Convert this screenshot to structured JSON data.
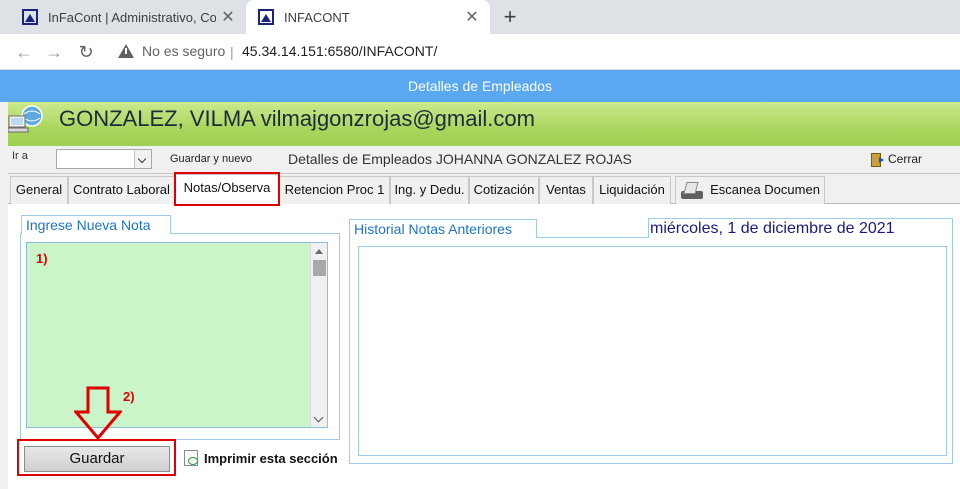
{
  "browser": {
    "tabs": [
      {
        "title": "InFaCont | Administrativo, Contab",
        "active": false
      },
      {
        "title": "INFACONT",
        "active": true
      }
    ],
    "close_glyph": "✕",
    "new_tab_glyph": "+",
    "security_label": "No es seguro",
    "url": "45.34.14.151:6580/INFACONT/"
  },
  "app": {
    "window_title": "Detalles de Empleados",
    "employee_banner": "GONZALEZ, VILMA vilmajgonzrojas@gmail.com",
    "toolbar": {
      "ir_a_label": "Ir a",
      "guardar_nuevo": "Guardar y nuevo",
      "detail_title": "Detalles de Empleados JOHANNA GONZALEZ ROJAS",
      "cerrar": "Cerrar"
    },
    "tabs": [
      {
        "label": "General"
      },
      {
        "label": "Contrato Laboral"
      },
      {
        "label": "Notas/Observa"
      },
      {
        "label": "Retencion Proc 1"
      },
      {
        "label": "Ing. y Dedu."
      },
      {
        "label": "Cotización"
      },
      {
        "label": "Ventas"
      },
      {
        "label": "Liquidación"
      },
      {
        "label": "Escanea Documen"
      }
    ],
    "active_tab": "Notas/Observa",
    "nueva_nota": {
      "label": "Ingrese Nueva Nota",
      "value": ""
    },
    "historial": {
      "label": "Historial Notas Anteriores"
    },
    "fecha": "miércoles, 1 de diciembre de 2021",
    "guardar_button": "Guardar",
    "imprimir": "Imprimir esta sección",
    "annotations": {
      "step1": "1)",
      "step2": "2)"
    },
    "colors": {
      "title_bar": "#5aa9f0",
      "banner_green": "#a8d65e",
      "note_bg": "#c9f5c9",
      "highlight": "#e00000",
      "panel_text": "#1a75c9"
    }
  }
}
